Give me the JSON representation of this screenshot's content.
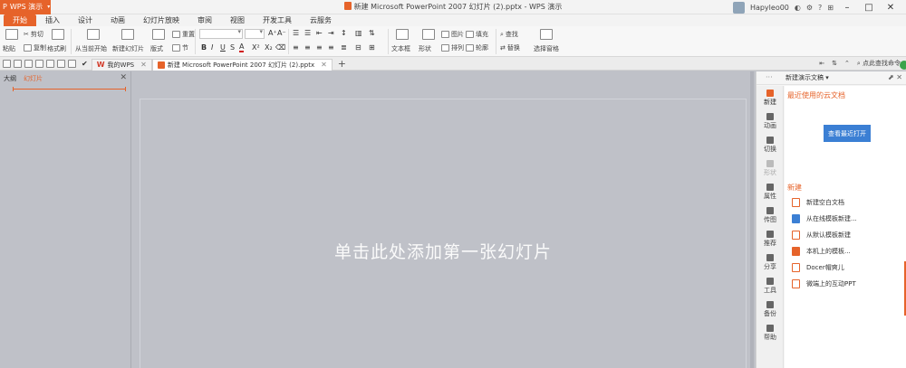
{
  "titlebar": {
    "app_name": "WPS 演示",
    "doc_title": "新建 Microsoft PowerPoint 2007 幻灯片 (2).pptx - WPS 演示",
    "user_name": "Hapyleo00",
    "help": "?"
  },
  "menu": {
    "tabs": [
      "开始",
      "插入",
      "设计",
      "动画",
      "幻灯片放映",
      "审阅",
      "视图",
      "开发工具",
      "云服务"
    ]
  },
  "ribbon": {
    "paste": "粘贴",
    "cut": "剪切",
    "copy": "复制",
    "format_painter": "格式刷",
    "from_current": "从当前开始",
    "new_slide": "新建幻灯片",
    "layout": "版式",
    "reset": "重置",
    "section": "节",
    "textbox": "文本框",
    "shape": "形状",
    "image": "图片",
    "arrange": "排列",
    "fill": "填充",
    "outline": "轮廓",
    "find": "查找",
    "replace": "替换",
    "select_pane": "选择窗格",
    "fmt_bold": "B",
    "fmt_italic": "I",
    "fmt_underline": "U",
    "fmt_strike": "S",
    "fmt_color": "A",
    "fmt_super": "X²",
    "fmt_sub": "X₂",
    "font_grow": "A⁺",
    "font_shrink": "A⁻"
  },
  "doc_tabs": {
    "my_wps": "我的WPS",
    "current": "新建 Microsoft PowerPoint 2007 幻灯片 (2).pptx",
    "search": "点此查找命令"
  },
  "left_pane": {
    "tab_outline": "大纲",
    "tab_slides": "幻灯片"
  },
  "slide": {
    "placeholder": "单击此处添加第一张幻灯片"
  },
  "sidebar": {
    "header": "新建演示文稿",
    "rail": [
      "新建",
      "动画",
      "切换",
      "形状",
      "属性",
      "传图",
      "推荐",
      "分享",
      "工具",
      "备份",
      "帮助"
    ],
    "recent_cloud": "最近使用的云文档",
    "view_cloud_btn": "查看最近打开",
    "new_heading": "新建",
    "new_items": [
      "新建空白文档",
      "从在线模板新建...",
      "从默认模板新建",
      "本机上的模板...",
      "Docer帽爽儿",
      "微端上的互动PPT"
    ]
  }
}
